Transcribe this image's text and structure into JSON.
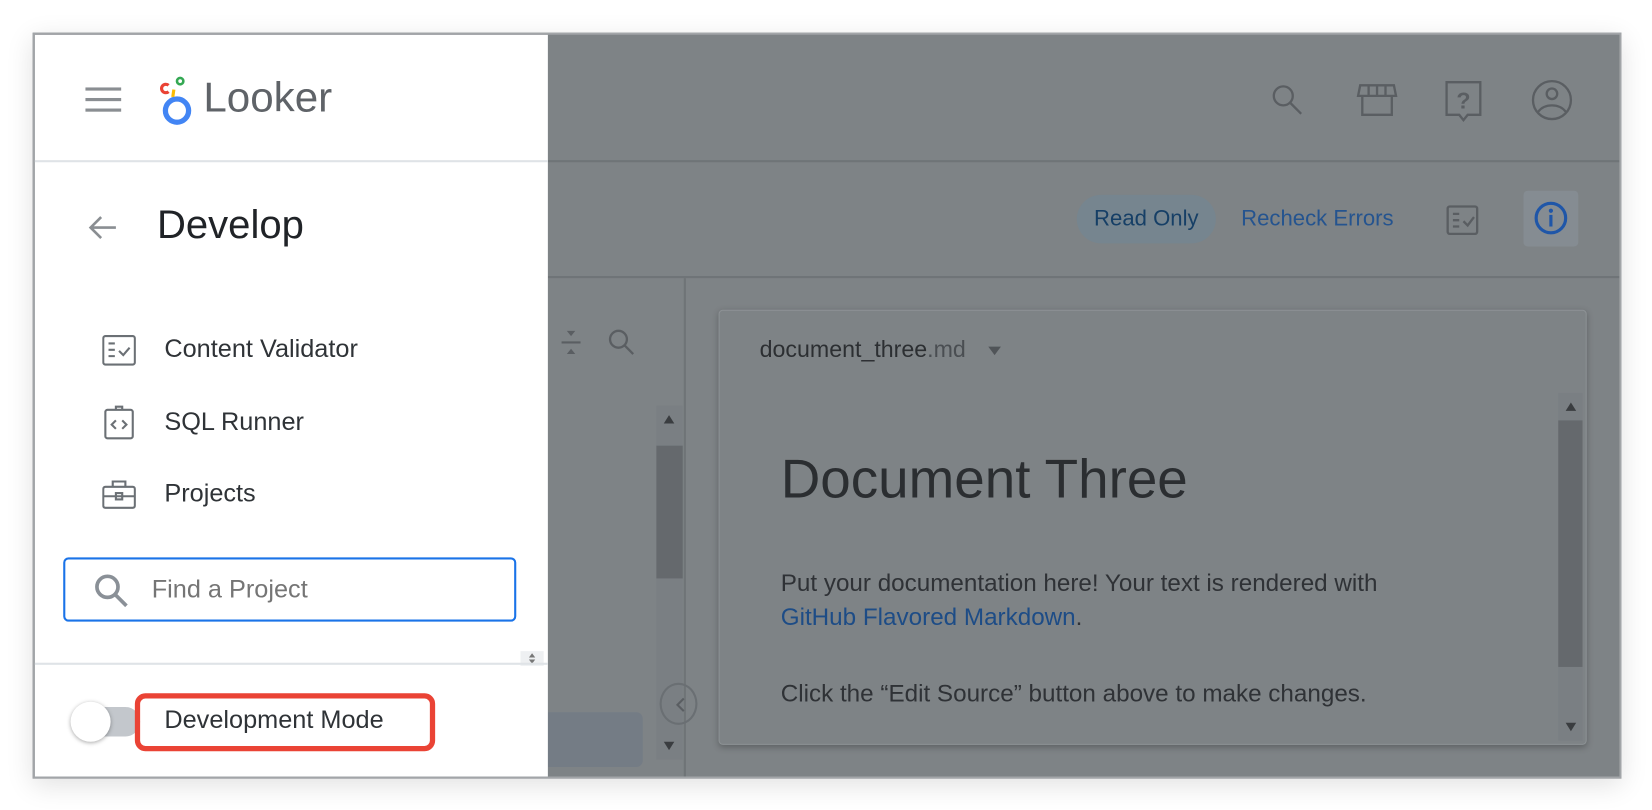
{
  "app": {
    "brand": "Looker",
    "brand_colors": [
      "#ea4335",
      "#34a853",
      "#fbbc04",
      "#4285f4"
    ]
  },
  "header": {
    "icons": [
      "search-icon",
      "marketplace-icon",
      "help-icon",
      "account-icon"
    ]
  },
  "sidebar": {
    "section_title": "Develop",
    "items": [
      {
        "label": "Content Validator",
        "icon": "content-validator-icon"
      },
      {
        "label": "SQL Runner",
        "icon": "sql-runner-icon"
      },
      {
        "label": "Projects",
        "icon": "briefcase-icon"
      }
    ],
    "search": {
      "placeholder": "Find a Project",
      "value": ""
    },
    "dev_mode": {
      "label": "Development Mode",
      "enabled": false,
      "highlight_color": "#ea4335"
    }
  },
  "toolbar": {
    "read_only_label": "Read Only",
    "recheck_label": "Recheck Errors"
  },
  "document": {
    "filename": "document_three",
    "extension": ".md",
    "heading": "Document Three",
    "para1_text": "Put your documentation here! Your text is rendered with",
    "para1_link": "GitHub Flavored Markdown",
    "para1_end": ".",
    "para2": "Click the “Edit Source” button above to make changes."
  },
  "colors": {
    "accent": "#1a73e8",
    "overlay": "#7e8386"
  }
}
